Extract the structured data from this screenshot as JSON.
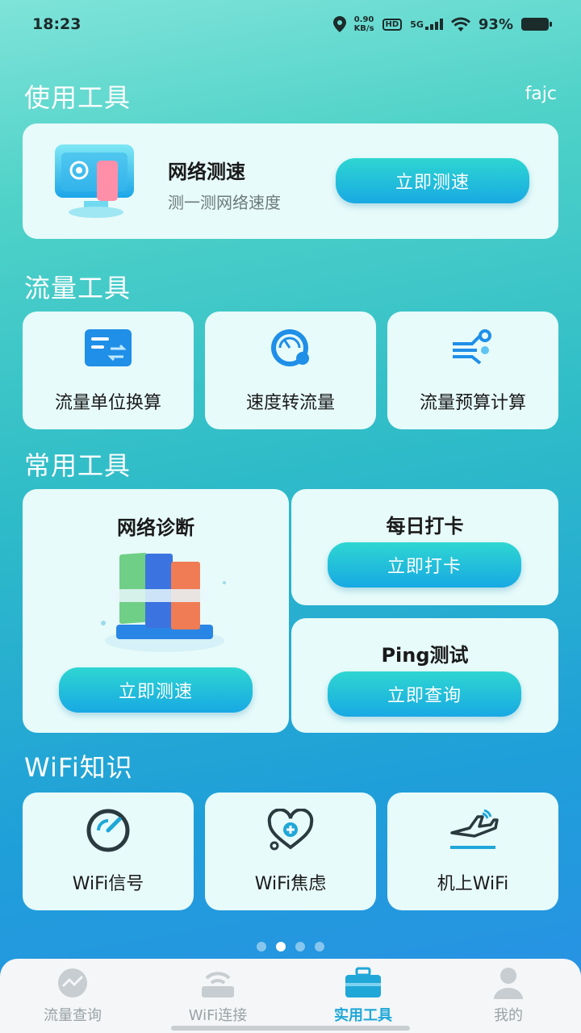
{
  "status": {
    "time": "18:23",
    "net_speed_value": "0.90",
    "net_speed_unit": "KB/s",
    "hd": "HD",
    "signal": "5G",
    "battery": "93%"
  },
  "header": {
    "user": "fajc"
  },
  "sections": {
    "use_tools": "使用工具",
    "traffic_tools": "流量工具",
    "common_tools": "常用工具",
    "wifi_knowledge": "WiFi知识"
  },
  "speed_test": {
    "title": "网络测速",
    "subtitle": "测一测网络速度",
    "button": "立即测速"
  },
  "traffic_items": [
    {
      "label": "流量单位换算",
      "icon": "conversion-icon"
    },
    {
      "label": "速度转流量",
      "icon": "speedometer-icon"
    },
    {
      "label": "流量预算计算",
      "icon": "budget-icon"
    }
  ],
  "common": {
    "diagnose": {
      "title": "网络诊断",
      "button": "立即测速"
    },
    "checkin": {
      "title": "每日打卡",
      "button": "立即打卡"
    },
    "ping": {
      "title": "Ping测试",
      "button": "立即查询"
    }
  },
  "wifi_items": [
    {
      "label": "WiFi信号",
      "icon": "signal-gauge-icon"
    },
    {
      "label": "WiFi焦虑",
      "icon": "heart-stethoscope-icon"
    },
    {
      "label": "机上WiFi",
      "icon": "airplane-wifi-icon"
    }
  ],
  "pager": {
    "count": 4,
    "active": 2
  },
  "tabs": [
    {
      "label": "流量查询",
      "icon": "traffic-icon"
    },
    {
      "label": "WiFi连接",
      "icon": "router-icon"
    },
    {
      "label": "实用工具",
      "icon": "toolbox-icon",
      "active": true
    },
    {
      "label": "我的",
      "icon": "user-icon"
    }
  ],
  "colors": {
    "accent": "#1fa7d8",
    "button_top": "#2ed6d1",
    "button_bottom": "#18a9e3",
    "card_bg": "#e7fbfa"
  }
}
